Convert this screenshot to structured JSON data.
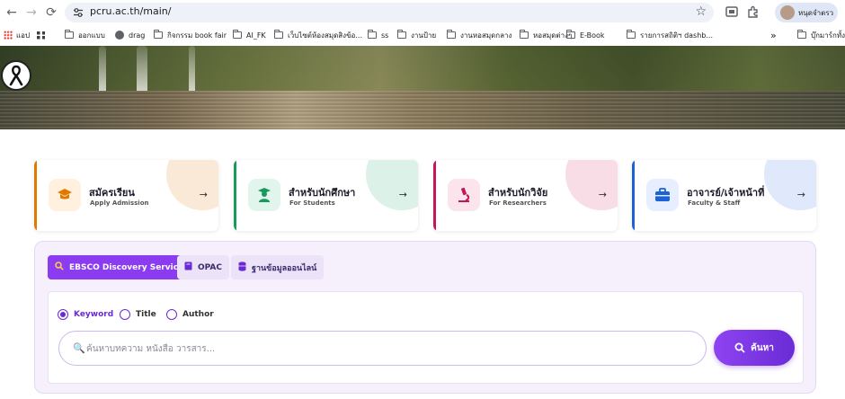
{
  "browser": {
    "url": "pcru.ac.th/main/",
    "profile_name": "หนุดจำตรว",
    "more_chevron": "»"
  },
  "bookmarks": {
    "apps_label": "แอป",
    "items": [
      "ออกแบบ",
      "drag",
      "กิจกรรม book fair",
      "AI_FK",
      "เว็บไซต์ห้องสมุดสิงข้อ...",
      "ss",
      "งานป้าย",
      "งานหอสมุดกลาง",
      "หอสมุดต่างๆ",
      "E-Book",
      "รายการสถิติฯ dashb..."
    ],
    "overflow_item": "บุ๊กมาร์กทั้งห"
  },
  "categories": [
    {
      "title": "สมัครเรียน",
      "subtitle": "Apply Admission",
      "accent": "#e07b00",
      "blob": "#fbe9d7",
      "icon_bg": "#fff0e0"
    },
    {
      "title": "สำหรับนักศึกษา",
      "subtitle": "For Students",
      "accent": "#179a5c",
      "blob": "#dcf2e8",
      "icon_bg": "#e2f5ec"
    },
    {
      "title": "สำหรับนักวิจัย",
      "subtitle": "For Researchers",
      "accent": "#c2185b",
      "blob": "#f8dde7",
      "icon_bg": "#fbe4ec"
    },
    {
      "title": "อาจารย์/เจ้าหน้าที่",
      "subtitle": "Faculty & Staff",
      "accent": "#1e63d6",
      "blob": "#e0e8fb",
      "icon_bg": "#e6eeff"
    }
  ],
  "search": {
    "tabs": [
      {
        "label": "EBSCO Discovery Service",
        "active": true
      },
      {
        "label": "OPAC",
        "active": false
      },
      {
        "label": "ฐานข้อมูลออนไลน์",
        "active": false
      }
    ],
    "options": [
      "Keyword",
      "Title",
      "Author"
    ],
    "selected_option": "Keyword",
    "placeholder": "ค้นหาบทความ หนังสือ วารสาร...",
    "button_label": "ค้นหา"
  }
}
